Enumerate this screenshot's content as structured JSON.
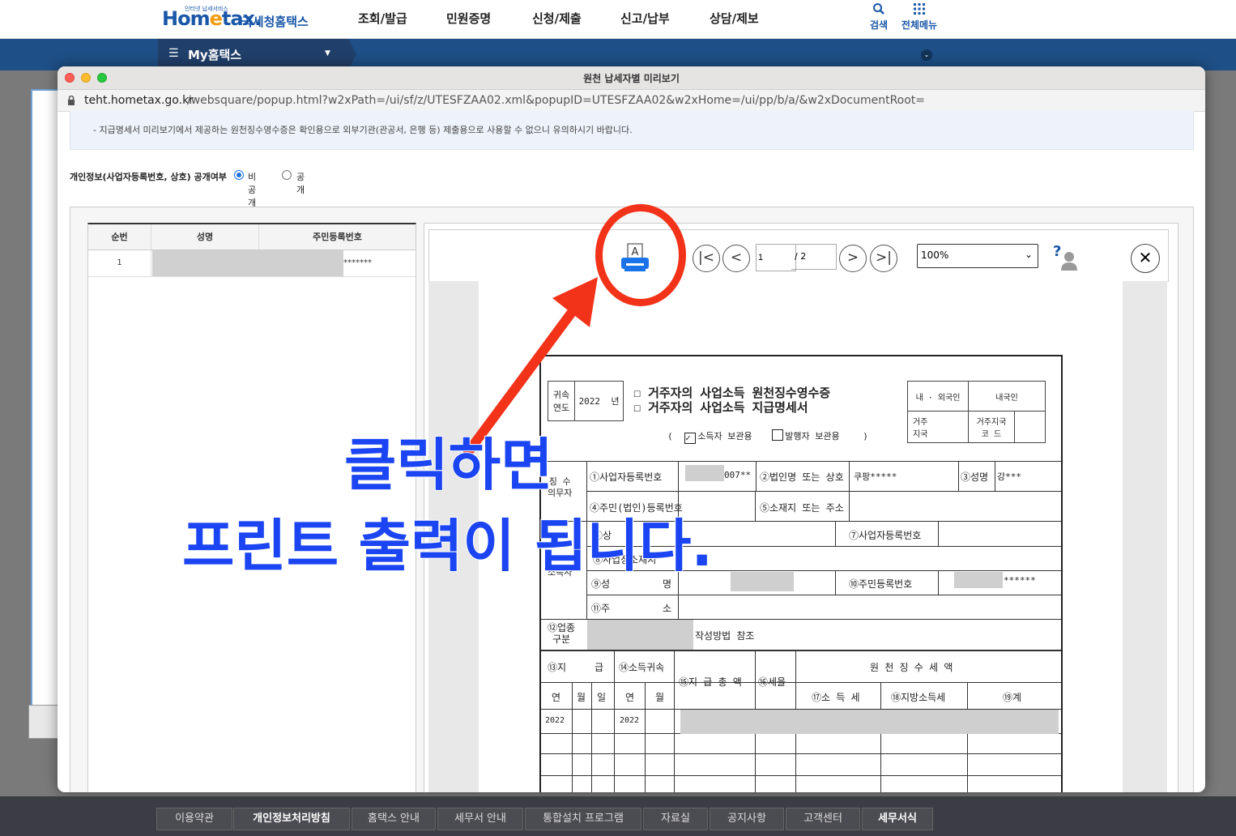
{
  "site": {
    "logo_small": "인터넷 납세서비스",
    "logo_main_a": "Hom",
    "logo_main_b": "e",
    "logo_main_c": "tax.",
    "logo_sub": "국세청홈택스",
    "nav": [
      "조회/발급",
      "민원증명",
      "신청/제출",
      "신고/납부",
      "상담/제보"
    ],
    "search_label": "검색",
    "allmenu_label": "전체메뉴",
    "myhome": "My홈택스"
  },
  "popup": {
    "title": "원천 납세자별 미리보기",
    "url_host": "teht.hometax.go.kr",
    "url_path": "/websquare/popup.html?w2xPath=/ui/sf/z/UTESFZAA02.xml&popupID=UTESFZAA02&w2xHome=/ui/pp/b/a/&w2xDocumentRoot=",
    "notice": "- 지급명세서 미리보기에서 제공하는 원천징수영수증은 확인용으로 외부기관(관공서, 은행 등) 제출용으로 사용할 수 없으니 유의하시기 바랍니다.",
    "privacy_label": "개인정보(사업자등록번호, 상호) 공개여부",
    "privacy_options": [
      "비공개",
      "공개"
    ],
    "privacy_selected": "비공개"
  },
  "list": {
    "headers": [
      "순번",
      "성명",
      "주민등록번호"
    ],
    "rows": [
      {
        "no": "1",
        "name": "",
        "rrn": "*******"
      }
    ]
  },
  "viewer": {
    "page_current": "1",
    "page_total": "/ 2",
    "zoom": "100%",
    "print_icon": "printer-icon",
    "help_icon": "help-icon"
  },
  "form": {
    "year_label_1": "귀속",
    "year_label_2": "연도",
    "year": "2022",
    "year_unit": "년",
    "title_1": "거주자의 사업소득 원천징수영수증",
    "title_2": "거주자의 사업소득 지급명세서",
    "copy_open": "(",
    "copy_income": "소득자 보관용",
    "copy_payer": "발행자 보관용",
    "copy_close": ")",
    "resident_type": "내 · 외국인",
    "resident_value": "내국인",
    "residence_country_1": "거주",
    "residence_country_2": "지국",
    "residence_code_1": "거주지국",
    "residence_code_2": "코    드",
    "withholder_1": "징  수",
    "withholder_2": "의무자",
    "f1_label": "①사업자등록번호",
    "f1_value": "007**",
    "f2_label": "②법인명 또는 상호",
    "f2_value": "쿠팡*****",
    "f3_label": "③성명",
    "f3_value": "강***",
    "f4_label": "④주민(법인)등록번호",
    "f5_label": "⑤소재지 또는 주소",
    "f6_label": "⑥상",
    "f7_label": "⑦사업자등록번호",
    "f8_label": "⑧사업장소재지",
    "earner_label": "소득자",
    "f9_label": "⑨성",
    "f9_label_2": "명",
    "f10_label": "⑩주민등록번호",
    "f10_value": "******",
    "f11_label": "⑪주",
    "f11_label_2": "소",
    "f12_label_1": "⑫업종",
    "f12_label_2": "구분",
    "f12_note": "작성방법 참조",
    "f13_label": "⑬지",
    "f13_label_2": "급",
    "f14_label": "⑭소득귀속",
    "f15_label": "⑮지 급 총 액",
    "f16_label": "⑯세율",
    "tax_header": "원  천  징  수  세  액",
    "f17_label": "⑰소 득 세",
    "f18_label": "⑱지방소득세",
    "f19_label": "⑲계",
    "col_y": "연",
    "col_m": "월",
    "col_d": "일",
    "row_year_1": "2022",
    "row_year_2": "2022"
  },
  "annotation": {
    "line1": "클릭하면",
    "line2": "프린트 출력이 됩니다."
  },
  "footer": {
    "links": [
      {
        "label": "이용약관",
        "highlight": false
      },
      {
        "label": "개인정보처리방침",
        "highlight": true
      },
      {
        "label": "홈택스 안내",
        "highlight": false
      },
      {
        "label": "세무서 안내",
        "highlight": false
      },
      {
        "label": "통합설치 프로그램",
        "highlight": false
      },
      {
        "label": "자료실",
        "highlight": false
      },
      {
        "label": "공지사항",
        "highlight": false
      },
      {
        "label": "고객센터",
        "highlight": false
      },
      {
        "label": "세무서식",
        "highlight": true
      }
    ]
  },
  "colors": {
    "brand_blue": "#1a57a8",
    "nav_bar": "#1e4f86",
    "annotation_red": "#f23219",
    "annotation_blue": "#1b44f2"
  }
}
